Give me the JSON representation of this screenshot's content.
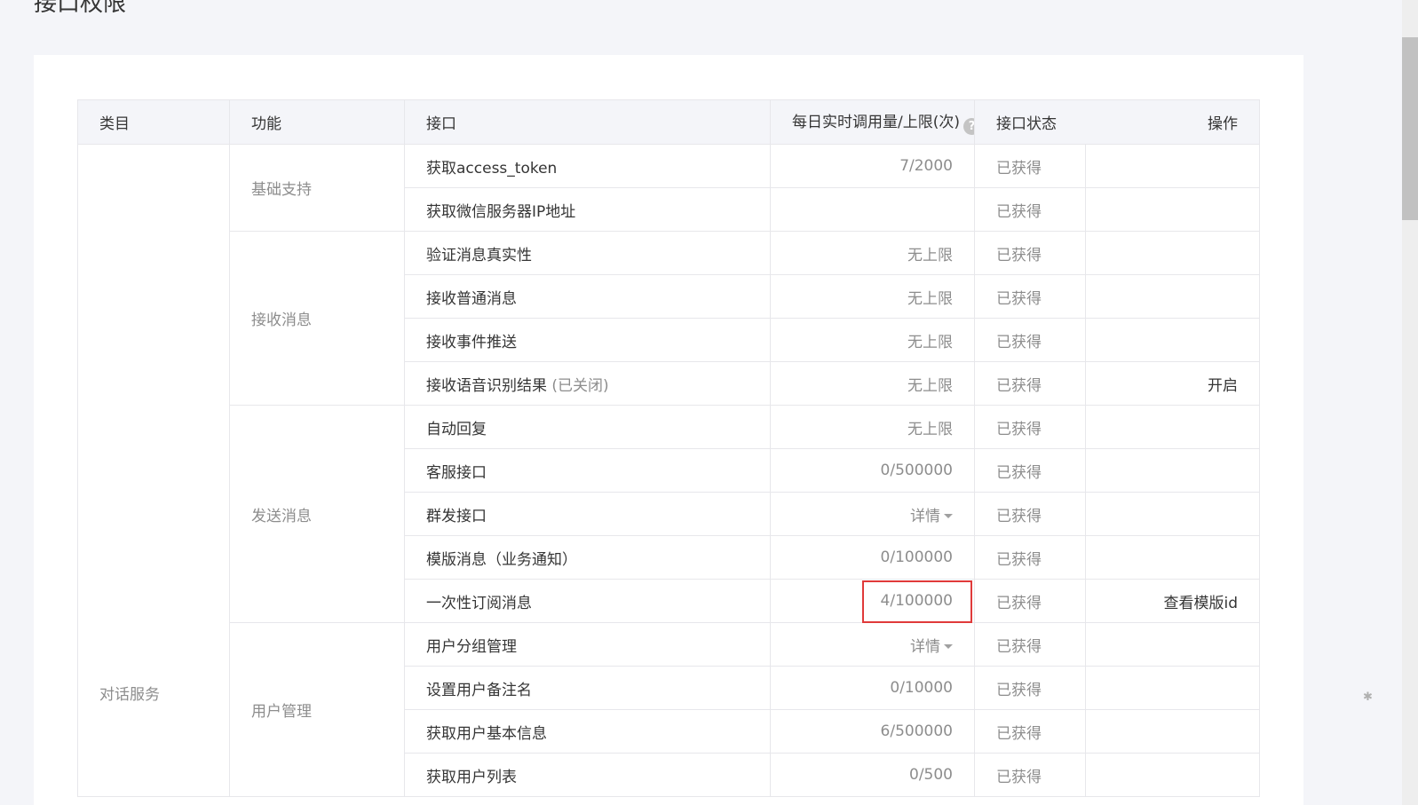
{
  "page": {
    "title": "接口权限"
  },
  "table": {
    "headers": {
      "category": "类目",
      "function": "功能",
      "api": "接口",
      "quota": "每日实时调用量/上限(次)",
      "status": "接口状态",
      "operation": "操作"
    },
    "category": "对话服务",
    "groups": [
      {
        "function": "基础支持",
        "rows": [
          {
            "api": "获取access_token",
            "quota": "7/2000",
            "status": "已获得"
          },
          {
            "api": "获取微信服务器IP地址",
            "quota": "",
            "status": "已获得"
          }
        ]
      },
      {
        "function": "接收消息",
        "rows": [
          {
            "api": "验证消息真实性",
            "quota": "无上限",
            "status": "已获得"
          },
          {
            "api": "接收普通消息",
            "quota": "无上限",
            "status": "已获得"
          },
          {
            "api": "接收事件推送",
            "quota": "无上限",
            "status": "已获得"
          },
          {
            "api": "接收语音识别结果",
            "api_note": "(已关闭)",
            "quota": "无上限",
            "status": "已获得",
            "operation": "开启"
          }
        ]
      },
      {
        "function": "发送消息",
        "rows": [
          {
            "api": "自动回复",
            "quota": "无上限",
            "status": "已获得"
          },
          {
            "api": "客服接口",
            "quota": "0/500000",
            "status": "已获得"
          },
          {
            "api": "群发接口",
            "quota": "详情",
            "status": "已获得"
          },
          {
            "api": "模版消息（业务通知）",
            "quota": "0/100000",
            "status": "已获得"
          },
          {
            "api": "一次性订阅消息",
            "quota": "4/100000",
            "status": "已获得",
            "operation": "查看模版id"
          }
        ]
      },
      {
        "function": "用户管理",
        "rows": [
          {
            "api": "用户分组管理",
            "quota": "详情",
            "status": "已获得"
          },
          {
            "api": "设置用户备注名",
            "quota": "0/10000",
            "status": "已获得"
          },
          {
            "api": "获取用户基本信息",
            "quota": "6/500000",
            "status": "已获得"
          },
          {
            "api": "获取用户列表",
            "quota": "0/500",
            "status": "已获得"
          }
        ]
      }
    ]
  },
  "icons": {
    "help": "question-circle-icon",
    "caret": "caret-down-icon"
  },
  "colors": {
    "highlight": "#e03a3a",
    "header_bg": "#f4f5f9"
  }
}
